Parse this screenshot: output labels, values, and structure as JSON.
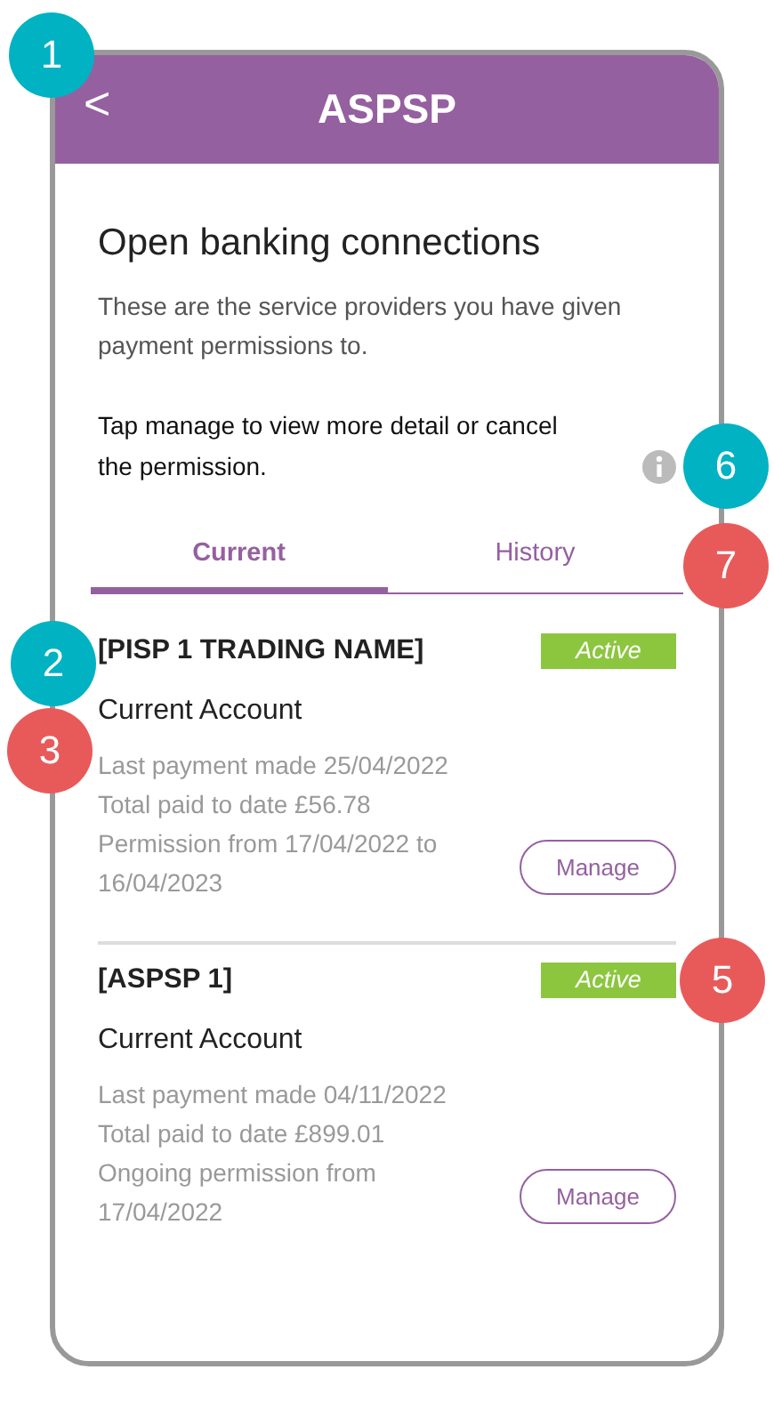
{
  "header": {
    "back": "<",
    "title": "ASPSP"
  },
  "heading": "Open banking connections",
  "intro": "These are the service providers you have given payment permissions to.",
  "hint": "Tap manage to view more detail or cancel the permission.",
  "tabs": [
    {
      "label": "Current",
      "selected": true
    },
    {
      "label": "History",
      "selected": false
    }
  ],
  "connections": [
    {
      "name": "[PISP 1 TRADING NAME]",
      "status": "Active",
      "account": "Current Account",
      "details": [
        "Last payment made 25/04/2022",
        "Total paid to date  £56.78",
        "Permission from 17/04/2022 to 16/04/2023"
      ],
      "button": "Manage"
    },
    {
      "name": "[ASPSP 1]",
      "status": "Active",
      "account": "Current Account",
      "details": [
        "Last payment made 04/11/2022",
        "Total paid to date  £899.01",
        "Ongoing permission from 17/04/2022"
      ],
      "button": "Manage"
    }
  ],
  "annotations": [
    {
      "label": "1",
      "color": "#00b2c2"
    },
    {
      "label": "6",
      "color": "#00b2c2"
    },
    {
      "label": "7",
      "color": "#e85a5a"
    },
    {
      "label": "2",
      "color": "#00b2c2"
    },
    {
      "label": "3",
      "color": "#e85a5a"
    },
    {
      "label": "5",
      "color": "#e85a5a"
    }
  ]
}
